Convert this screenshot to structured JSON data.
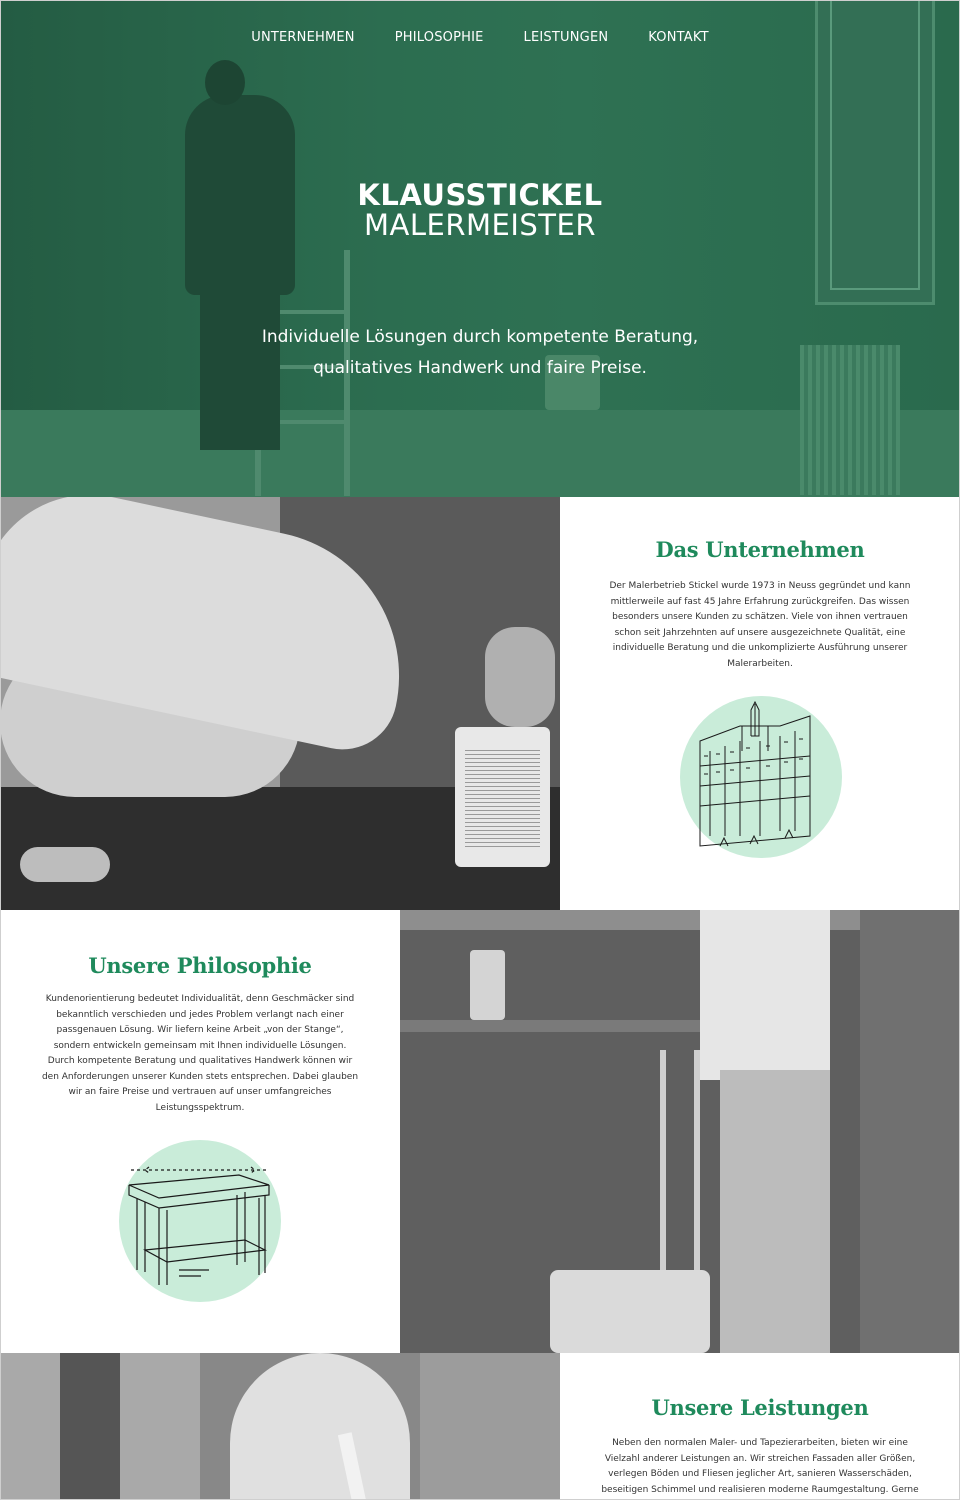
{
  "nav": {
    "items": [
      "UNTERNEHMEN",
      "PHILOSOPHIE",
      "LEISTUNGEN",
      "KONTAKT"
    ]
  },
  "hero": {
    "brand_line1": "KLAUSSTICKEL",
    "brand_line2": "MALERMEISTER",
    "tagline_line1": "Individuelle Lösungen durch kompetente Beratung,",
    "tagline_line2": "qualitatives Handwerk und faire Preise."
  },
  "sections": {
    "unternehmen": {
      "title": "Das Unternehmen",
      "text": "Der Malerbetrieb Stickel wurde 1973 in Neuss gegründet und kann mittlerweile auf fast 45 Jahre Erfahrung zurückgreifen. Das wissen besonders unsere Kunden zu schätzen. Viele von ihnen vertrauen schon seit Jahrzehnten auf unsere ausgezeichnete Qualität, eine individuelle Beratung und die unkomplizierte Ausführung unserer Malerarbeiten."
    },
    "philosophie": {
      "title": "Unsere Philosophie",
      "text": "Kundenorientierung bedeutet Individualität, denn Geschmäcker sind bekanntlich verschieden und jedes Problem verlangt nach einer passgenauen Lösung. Wir liefern keine Arbeit „von der Stange“, sondern entwickeln gemeinsam mit Ihnen individuelle Lösungen. Durch kompetente Beratung und qualitatives Handwerk können wir den Anforderungen unserer Kunden stets entsprechen. Dabei glauben wir an faire Preise und vertrauen auf unser umfangreiches Leistungsspektrum."
    },
    "leistungen": {
      "title": "Unsere Leistungen",
      "text": "Neben den normalen Maler- und Tapezierarbeiten, bieten wir eine Vielzahl anderer Leistungen an. Wir streichen Fassaden aller Größen, verlegen Böden und Fliesen jeglicher Art, sanieren Wasserschäden, beseitigen Schimmel und realisieren moderne Raumgestaltung. Gerne entwickeln wir"
    }
  },
  "colors": {
    "hero_overlay": "#2b6a4e",
    "accent_green": "#1f8a5c",
    "illustration_circle": "#c9ecd9"
  },
  "icons": {
    "illustration_1": "city-cathedral-sketch",
    "illustration_2": "workbench-sketch"
  }
}
